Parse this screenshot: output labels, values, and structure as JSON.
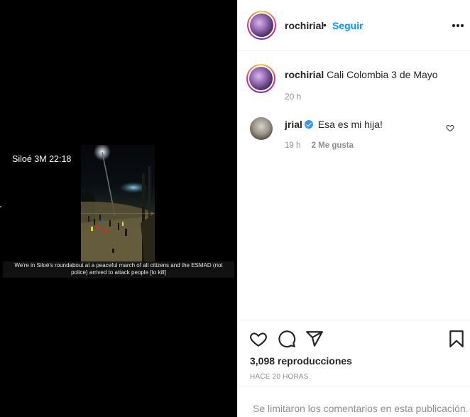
{
  "media": {
    "timestamp_overlay": "Siloé 3M 22:18",
    "subtitle": "We're in Siloé's roundabout at a peaceful march of all citizens and the ESMAD (riot police) arrived to attack people [to kill]"
  },
  "header": {
    "username": "rochirial",
    "separator": "•",
    "follow_label": "Seguir",
    "more_icon": "more-horizontal-icon"
  },
  "caption": {
    "username": "rochirial",
    "text": "Cali Colombia 3 de Mayo",
    "time": "20 h"
  },
  "comment": {
    "username": "jrial",
    "verified_icon": "verified-badge-icon",
    "text": "Esa es mi hija!",
    "time": "19 h",
    "likes": "2 Me gusta",
    "like_icon": "heart-outline-icon"
  },
  "actions": {
    "like_icon": "heart-icon",
    "comment_icon": "comment-icon",
    "share_icon": "paper-plane-icon",
    "save_icon": "bookmark-icon",
    "views": "3,098 reproducciones",
    "posted": "HACE 20 HORAS",
    "comments_limited": "Se limitaron los comentarios en esta publicación."
  },
  "colors": {
    "accent": "#0095f6",
    "verified": "#3897f0",
    "text": "#262626",
    "muted": "#8e8e8e"
  }
}
